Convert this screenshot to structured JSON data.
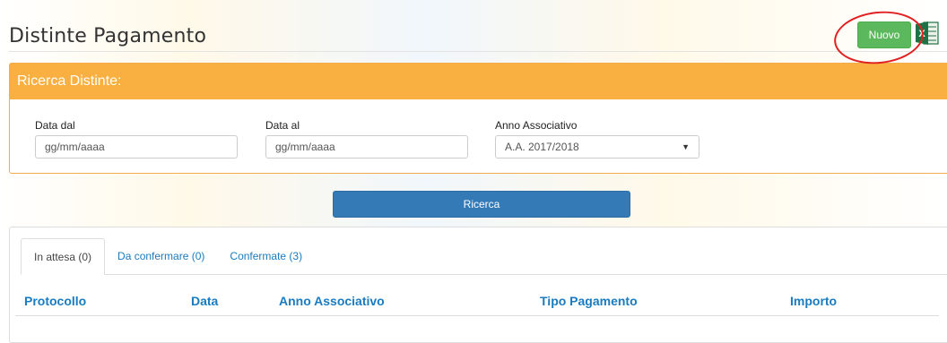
{
  "header": {
    "title": "Distinte Pagamento",
    "new_button": "Nuovo",
    "export_icon": "excel-icon"
  },
  "search": {
    "panel_title": "Ricerca Distinte:",
    "date_from": {
      "label": "Data dal",
      "placeholder": "gg/mm/aaaa"
    },
    "date_to": {
      "label": "Data al",
      "placeholder": "gg/mm/aaaa"
    },
    "year": {
      "label": "Anno Associativo",
      "selected": "A.A. 2017/2018"
    },
    "submit_button": "Ricerca"
  },
  "tabs": [
    {
      "label": "In attesa (0)",
      "active": true
    },
    {
      "label": "Da confermare (0)",
      "active": false
    },
    {
      "label": "Confermate (3)",
      "active": false
    }
  ],
  "table": {
    "columns": [
      "Protocollo",
      "Data",
      "Anno Associativo",
      "Tipo Pagamento",
      "Importo"
    ],
    "rows": []
  },
  "colors": {
    "accent_orange": "#f9b040",
    "primary_blue": "#337ab7",
    "success_green": "#5cb85c",
    "annotation_red": "#e02020"
  }
}
